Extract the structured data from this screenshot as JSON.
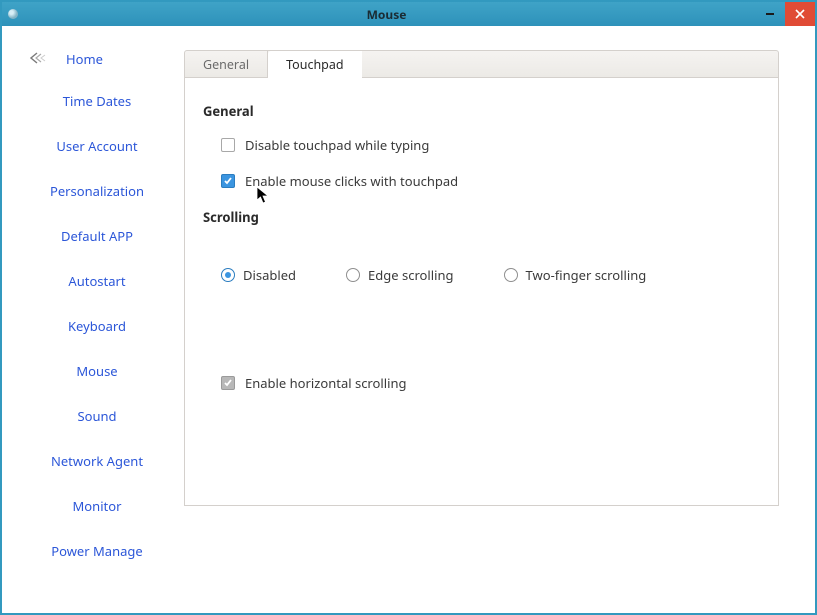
{
  "window_title": "Mouse",
  "sidebar": {
    "home_label": "Home",
    "items": [
      "Time Dates",
      "User Account",
      "Personalization",
      "Default APP",
      "Autostart",
      "Keyboard",
      "Mouse",
      "Sound",
      "Network Agent",
      "Monitor",
      "Power Manage"
    ]
  },
  "tabs": {
    "general": "General",
    "touchpad": "Touchpad"
  },
  "panel": {
    "section_general": "General",
    "disable_while_typing": "Disable touchpad while typing",
    "enable_clicks": "Enable mouse clicks with touchpad",
    "section_scrolling": "Scrolling",
    "scroll_disabled": "Disabled",
    "scroll_edge": "Edge scrolling",
    "scroll_twofinger": "Two-finger scrolling",
    "enable_horizontal": "Enable horizontal scrolling"
  }
}
